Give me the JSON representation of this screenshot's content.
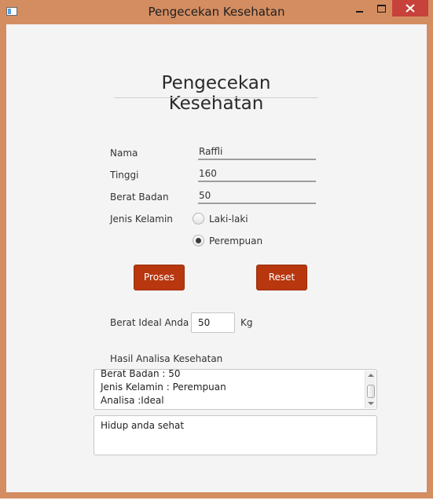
{
  "window": {
    "title": "Pengecekan Kesehatan",
    "accent_color": "#d48d61",
    "close_color": "#c7423a"
  },
  "form": {
    "heading": "Pengecekan Kesehatan",
    "name_label": "Nama",
    "name_value": "Raffli",
    "height_label": "Tinggi",
    "height_value": "160",
    "weight_label": "Berat Badan",
    "weight_value": "50",
    "gender_label": "Jenis Kelamin",
    "gender_options": [
      "Laki-laki",
      "Perempuan"
    ],
    "gender_selected": "Perempuan"
  },
  "buttons": {
    "process_label": "Proses",
    "reset_label": "Reset",
    "color": "#b8370e"
  },
  "result": {
    "ideal_label": "Berat Ideal Anda",
    "ideal_value": "50",
    "unit": "Kg",
    "analysis_label": "Hasil Analisa Kesehatan",
    "analysis_lines": [
      "Berat Badan : 50",
      "Jenis Kelamin : Perempuan",
      "Analisa :Ideal"
    ],
    "summary_text": "Hidup anda sehat"
  }
}
